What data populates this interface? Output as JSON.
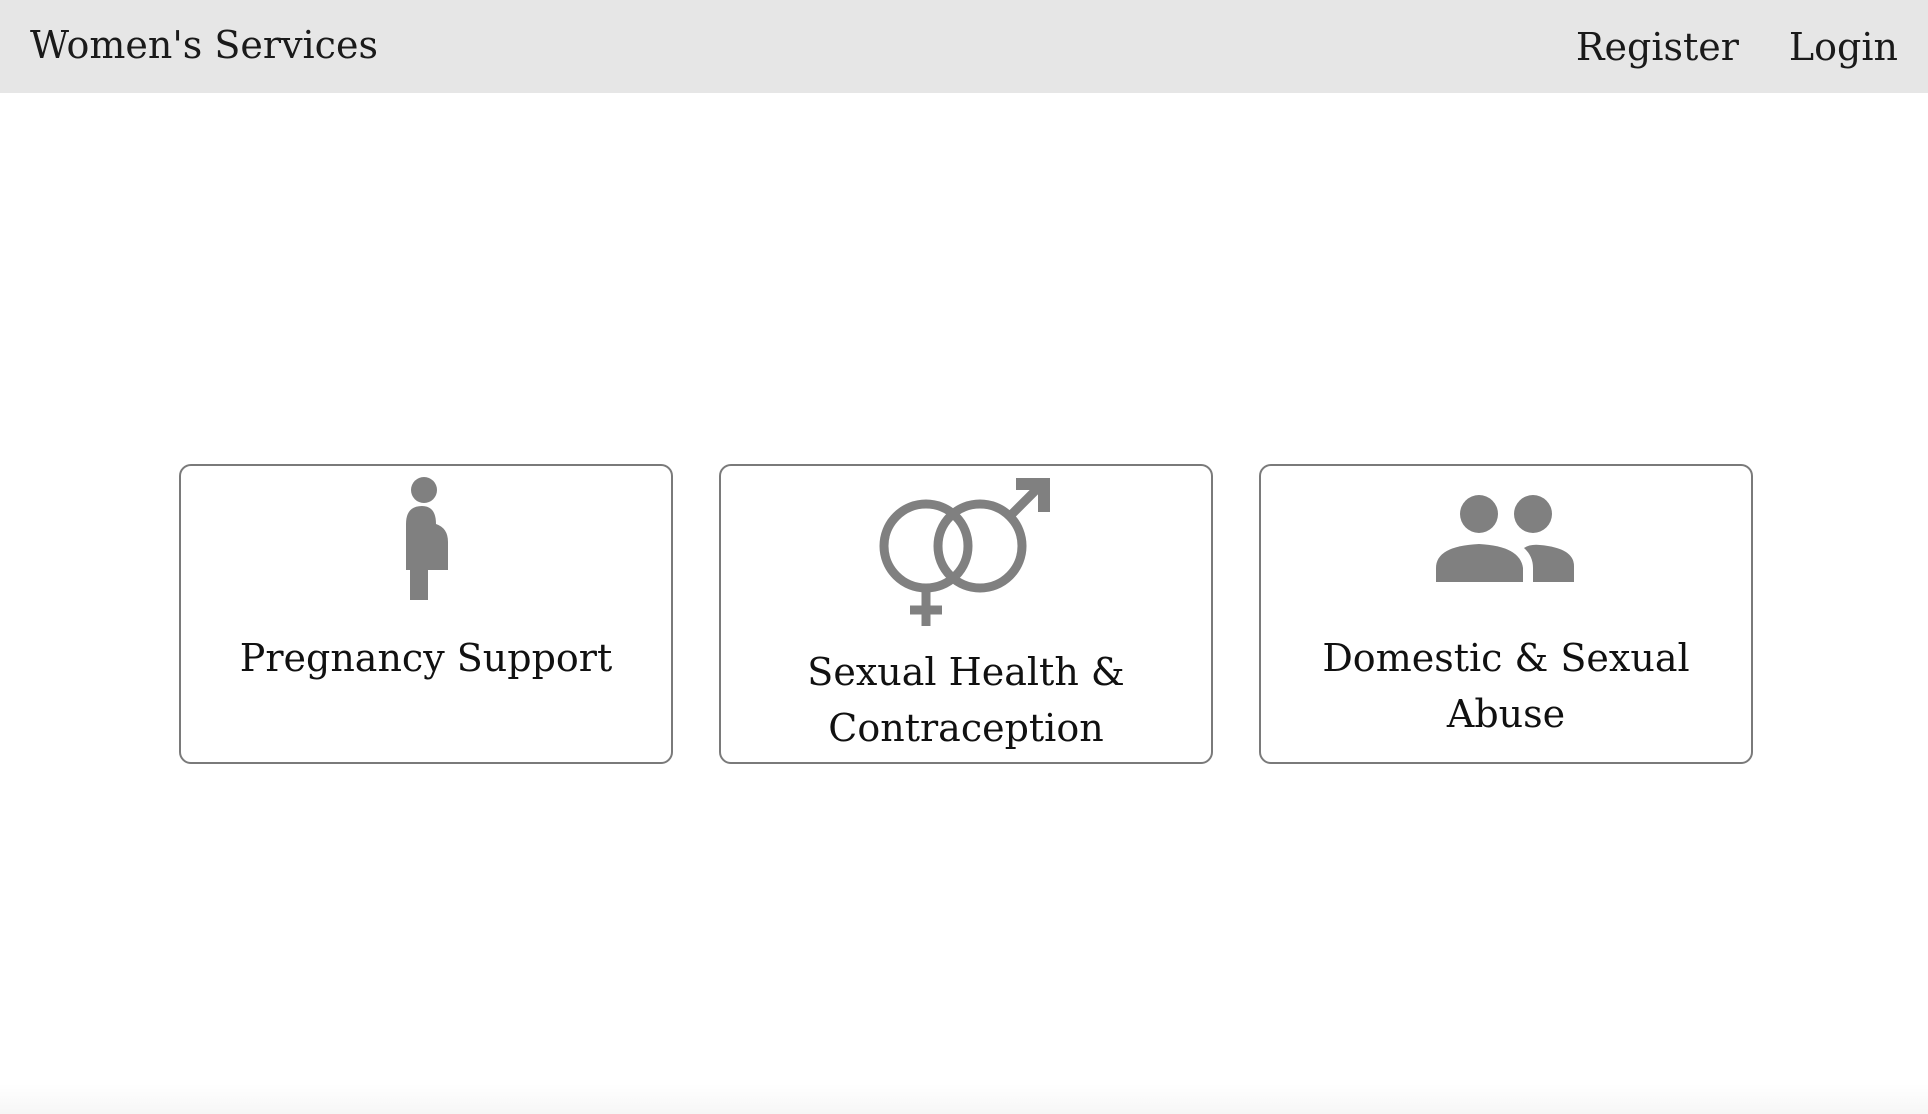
{
  "navbar": {
    "brand": "Women's Services",
    "links": [
      {
        "label": "Register"
      },
      {
        "label": "Login"
      }
    ]
  },
  "cards": [
    {
      "label": "Pregnancy Support",
      "icon": "pregnant-woman-icon"
    },
    {
      "label": "Sexual Health & Contraception",
      "icon": "gender-symbols-icon"
    },
    {
      "label": "Domestic & Sexual Abuse",
      "icon": "people-icon"
    }
  ],
  "colors": {
    "navbar_bg": "#e6e6e6",
    "icon": "#808080",
    "card_border": "#7a7a7a"
  }
}
